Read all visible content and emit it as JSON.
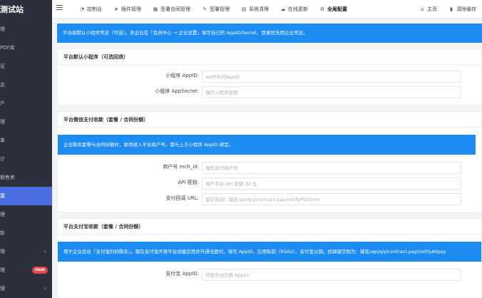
{
  "sidebar": {
    "brand": "测试站",
    "items": [
      {
        "label": "理"
      },
      {
        "label": "PDF库"
      },
      {
        "label": "证"
      },
      {
        "label": "志"
      },
      {
        "label": "户"
      },
      {
        "label": "理"
      },
      {
        "label": "单"
      },
      {
        "label": "计"
      },
      {
        "label": "额售卖"
      },
      {
        "label": "置"
      },
      {
        "label": "理"
      },
      {
        "label": "新"
      },
      {
        "label": "理"
      },
      {
        "label": "理",
        "badge": "new"
      },
      {
        "label": "理"
      }
    ]
  },
  "topbar": {
    "nav": [
      {
        "icon": "dashboard-icon",
        "glyph": "◔",
        "label": "控制台"
      },
      {
        "icon": "plugin-icon",
        "glyph": "➤",
        "label": "插件管理"
      },
      {
        "icon": "contract-icon",
        "glyph": "▦",
        "label": "签署合同管理"
      },
      {
        "icon": "sign-icon",
        "glyph": "✎",
        "label": "签署管理"
      },
      {
        "icon": "cleanup-icon",
        "glyph": "▤",
        "label": "系统清理"
      },
      {
        "icon": "update-icon",
        "glyph": "☁",
        "label": "在线更新"
      },
      {
        "icon": "settings-icon",
        "glyph": "⚙",
        "label": "全局配置"
      }
    ],
    "home": {
      "glyph": "⌂",
      "label": "主页"
    },
    "clear_cache": {
      "glyph": "▮",
      "label": "清除缓存"
    }
  },
  "banner": "平台级默认小程序凭证（可选）。各企业在「会员中心 → 企业设置」填写自己的 AppID/Secret，登录优先用企业凭证。",
  "miniapp": {
    "title": "平台默认小程序（可选回退）",
    "appid_label": "小程序 AppID:",
    "appid_placeholder": "wx开头的AppID",
    "secret_label": "小程序 AppSecret:",
    "secret_placeholder": "微信小程序密钥"
  },
  "wxpay": {
    "title": "平台微信支付收款（套餐 / 合同份额）",
    "notice": "企业购买套餐与合同份额时，款项进入平台商户号。需与上方小程序 AppID 绑定。",
    "mchid_label": "商户号 mch_id:",
    "mchid_placeholder": "微信支付商户号",
    "apikey_label": "API 密钥:",
    "apikey_placeholder": "商户平台 API 密钥 32 位",
    "notify_label": "支付回调 URL:",
    "notify_placeholder": "留空自动：域名/api/qiyicontract.pay/notifyPlatform"
  },
  "alipay": {
    "title": "平台支付宝收款（套餐 / 合同份额）",
    "notice": "用于企业后台「支付宝扫码购买」。需在支付宝开放平台创建应用并开通当面付，填写 AppID、应用私钥（RSA2）、支付宝公钥。回调留空则为：域名/api/qiyicontract.pay/notifyAlipay",
    "appid_label": "支付宝 AppID:",
    "appid_placeholder": "开放平台应用 AppID"
  }
}
